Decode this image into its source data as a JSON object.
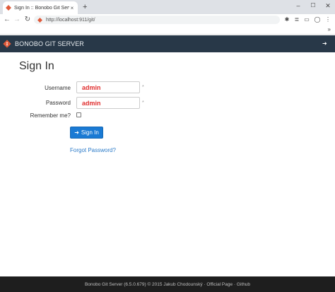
{
  "browser": {
    "tab_title": "Sign In :: Bonobo Git Server",
    "tab_close": "×",
    "new_tab": "+",
    "url": "http://localhost:911/git/",
    "back": "←",
    "forward": "→",
    "reload": "↻",
    "window_minimize": "–",
    "window_maximize": "☐",
    "window_close": "✕",
    "toolbar_icons": [
      "extensions-icon",
      "reading-list-icon",
      "tab-search-icon",
      "profile-icon",
      "menu-icon"
    ],
    "bookmark_more": "»"
  },
  "navbar": {
    "brand": "BONOBO GIT SERVER",
    "signin_label": "Sign In",
    "brand_color": "#e05a3a"
  },
  "form": {
    "heading": "Sign In",
    "username_label": "Username",
    "username_value": "admin",
    "password_label": "Password",
    "password_value": "admin",
    "remember_label": "Remember me?",
    "required_mark": "*",
    "submit_label": "Sign In",
    "forgot_label": "Forgot Password?"
  },
  "footer": {
    "text": "Bonobo Git Server (6.5.0.679) © 2015 Jakub Chodounský · Official Page · Github"
  },
  "colors": {
    "navbar_bg": "#283848",
    "primary": "#1a7ad4",
    "link": "#2a7ac8",
    "input_text": "#e03030",
    "footer_bg": "#1e1e1e"
  }
}
